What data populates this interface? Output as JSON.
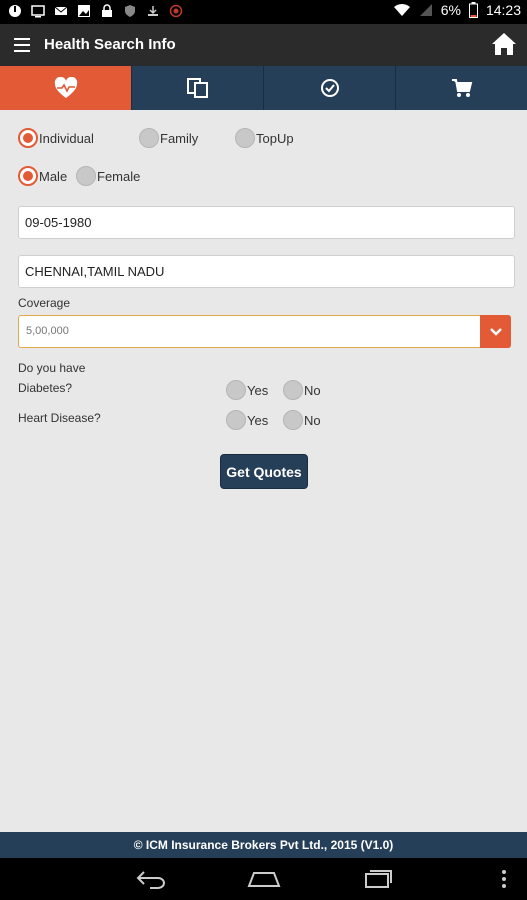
{
  "status_bar": {
    "battery": "6%",
    "time": "14:23"
  },
  "app_bar": {
    "title": "Health Search Info"
  },
  "tabs": [
    {
      "name": "health-heart-icon",
      "active": true
    },
    {
      "name": "documents-icon",
      "active": false
    },
    {
      "name": "check-circle-icon",
      "active": false
    },
    {
      "name": "cart-icon",
      "active": false
    }
  ],
  "form": {
    "plan_options": [
      "Individual",
      "Family",
      "TopUp"
    ],
    "plan_selected": "Individual",
    "gender_options": [
      "Male",
      "Female"
    ],
    "gender_selected": "Male",
    "dob": "09-05-1980",
    "location": "CHENNAI,TAMIL NADU",
    "coverage_label": "Coverage",
    "coverage_value": "5,00,000",
    "question_intro": "Do you have",
    "diabetes_label": "Diabetes?",
    "heart_label": "Heart Disease?",
    "yes_label": "Yes",
    "no_label": "No",
    "submit_label": "Get Quotes"
  },
  "footer": {
    "text": "© ICM Insurance Brokers Pvt Ltd., 2015 (V1.0)"
  },
  "colors": {
    "accent": "#e25a36",
    "navy": "#263f58",
    "appbar": "#2b2b2b",
    "background": "#e8e8e8"
  }
}
